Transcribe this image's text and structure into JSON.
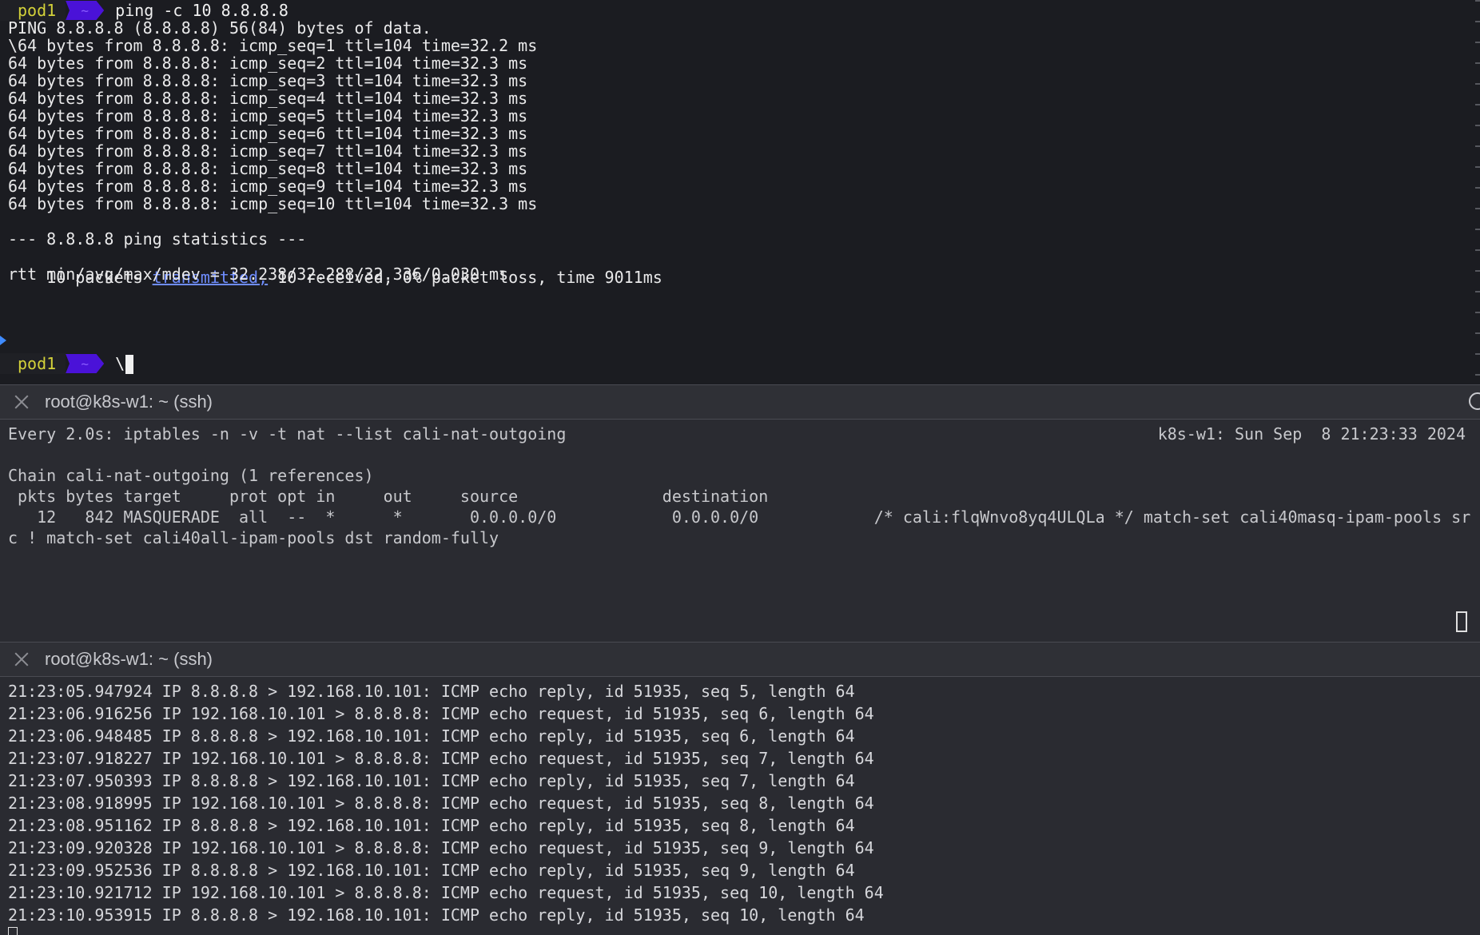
{
  "pane1": {
    "prompt_host": "pod1",
    "prompt_dir": "~",
    "command": "ping -c 10 8.8.8.8",
    "output": [
      "PING 8.8.8.8 (8.8.8.8) 56(84) bytes of data.",
      "\\64 bytes from 8.8.8.8: icmp_seq=1 ttl=104 time=32.2 ms",
      "64 bytes from 8.8.8.8: icmp_seq=2 ttl=104 time=32.3 ms",
      "64 bytes from 8.8.8.8: icmp_seq=3 ttl=104 time=32.3 ms",
      "64 bytes from 8.8.8.8: icmp_seq=4 ttl=104 time=32.3 ms",
      "64 bytes from 8.8.8.8: icmp_seq=5 ttl=104 time=32.3 ms",
      "64 bytes from 8.8.8.8: icmp_seq=6 ttl=104 time=32.3 ms",
      "64 bytes from 8.8.8.8: icmp_seq=7 ttl=104 time=32.3 ms",
      "64 bytes from 8.8.8.8: icmp_seq=8 ttl=104 time=32.3 ms",
      "64 bytes from 8.8.8.8: icmp_seq=9 ttl=104 time=32.3 ms",
      "64 bytes from 8.8.8.8: icmp_seq=10 ttl=104 time=32.3 ms",
      "",
      "--- 8.8.8.8 ping statistics ---"
    ],
    "stats_prefix": "10 packets ",
    "stats_link": "transmitted,",
    "stats_suffix": " 10 received, 0% packet loss, time 9011ms",
    "rtt_line": "rtt min/avg/max/mdev = 32.238/32.288/32.336/0.030 ms",
    "prompt2_host": "pod1",
    "prompt2_dir": "~",
    "prompt2_input": "\\"
  },
  "pane2": {
    "title": "root@k8s-w1: ~ (ssh)",
    "watch_cmd": "Every 2.0s: iptables -n -v -t nat --list cali-nat-outgoing",
    "watch_status": "k8s-w1: Sun Sep  8 21:23:33 2024",
    "lines": [
      "",
      "Chain cali-nat-outgoing (1 references)",
      " pkts bytes target     prot opt in     out     source               destination",
      "   12   842 MASQUERADE  all  --  *      *       0.0.0.0/0            0.0.0.0/0            /* cali:flqWnvo8yq4ULQLa */ match-set cali40masq-ipam-pools sr",
      "c ! match-set cali40all-ipam-pools dst random-fully"
    ]
  },
  "pane3": {
    "title": "root@k8s-w1: ~ (ssh)",
    "lines": [
      "21:23:05.947924 IP 8.8.8.8 > 192.168.10.101: ICMP echo reply, id 51935, seq 5, length 64",
      "21:23:06.916256 IP 192.168.10.101 > 8.8.8.8: ICMP echo request, id 51935, seq 6, length 64",
      "21:23:06.948485 IP 8.8.8.8 > 192.168.10.101: ICMP echo reply, id 51935, seq 6, length 64",
      "21:23:07.918227 IP 192.168.10.101 > 8.8.8.8: ICMP echo request, id 51935, seq 7, length 64",
      "21:23:07.950393 IP 8.8.8.8 > 192.168.10.101: ICMP echo reply, id 51935, seq 7, length 64",
      "21:23:08.918995 IP 192.168.10.101 > 8.8.8.8: ICMP echo request, id 51935, seq 8, length 64",
      "21:23:08.951162 IP 8.8.8.8 > 192.168.10.101: ICMP echo reply, id 51935, seq 8, length 64",
      "21:23:09.920328 IP 192.168.10.101 > 8.8.8.8: ICMP echo request, id 51935, seq 9, length 64",
      "21:23:09.952536 IP 8.8.8.8 > 192.168.10.101: ICMP echo reply, id 51935, seq 9, length 64",
      "21:23:10.921712 IP 192.168.10.101 > 8.8.8.8: ICMP echo request, id 51935, seq 10, length 64",
      "21:23:10.953915 IP 8.8.8.8 > 192.168.10.101: ICMP echo reply, id 51935, seq 10, length 64"
    ]
  },
  "colors": {
    "prompt_host": "#d4d23a",
    "prompt_dir_bg": "#4a12d8",
    "link": "#6f8dff",
    "pane_top_bg": "#1b1c21",
    "pane_bottom_bg": "#2a2b31",
    "header_bg": "#2f3036"
  }
}
